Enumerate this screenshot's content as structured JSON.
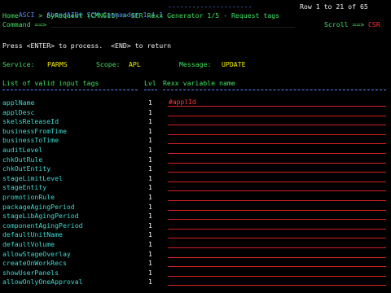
{
  "header": {
    "product": "ASCI - AbendAID® SCM Commander 1.4.1",
    "rule": "---------------------",
    "row_status": "Row 1 to 21 of 65",
    "breadcrumb": "Home     > byRequest (CMN611) > SER Rexx Generator 1/5 - Request tags",
    "command_label": "Command ==>",
    "scroll_label": "Scroll ==>",
    "scroll_value": "CSR"
  },
  "instructions": {
    "text": "Press <ENTER> to process.  <END> to return"
  },
  "context": {
    "service_label": "Service:",
    "service_value": "PARMS",
    "scope_label": "Scope:",
    "scope_value": "APL",
    "message_label": "Message:",
    "message_value": "UPDATE"
  },
  "table": {
    "col_tags": "List of valid input tags",
    "col_lvl": "Lvl",
    "col_rexx": "Rexx variable name",
    "rows": [
      {
        "tag": "applName",
        "lvl": "1",
        "rexx": "#applId"
      },
      {
        "tag": "applDesc",
        "lvl": "1",
        "rexx": ""
      },
      {
        "tag": "skelsReleaseId",
        "lvl": "1",
        "rexx": ""
      },
      {
        "tag": "businessFromTime",
        "lvl": "1",
        "rexx": ""
      },
      {
        "tag": "businessToTime",
        "lvl": "1",
        "rexx": ""
      },
      {
        "tag": "auditLevel",
        "lvl": "1",
        "rexx": ""
      },
      {
        "tag": "chkOutRule",
        "lvl": "1",
        "rexx": ""
      },
      {
        "tag": "chkOutEntity",
        "lvl": "1",
        "rexx": ""
      },
      {
        "tag": "stageLimitLevel",
        "lvl": "1",
        "rexx": ""
      },
      {
        "tag": "stageEntity",
        "lvl": "1",
        "rexx": ""
      },
      {
        "tag": "promotionRule",
        "lvl": "1",
        "rexx": ""
      },
      {
        "tag": "packageAgingPeriod",
        "lvl": "1",
        "rexx": ""
      },
      {
        "tag": "stageLibAgingPeriod",
        "lvl": "1",
        "rexx": ""
      },
      {
        "tag": "componentAgingPeriod",
        "lvl": "1",
        "rexx": ""
      },
      {
        "tag": "defaultUnitName",
        "lvl": "1",
        "rexx": ""
      },
      {
        "tag": "defaultVolume",
        "lvl": "1",
        "rexx": ""
      },
      {
        "tag": "allowStageOverlay",
        "lvl": "1",
        "rexx": ""
      },
      {
        "tag": "createOnWorkRecs",
        "lvl": "1",
        "rexx": ""
      },
      {
        "tag": "showUserPanels",
        "lvl": "1",
        "rexx": ""
      },
      {
        "tag": "allowOnlyOneApproval",
        "lvl": "1",
        "rexx": ""
      }
    ]
  },
  "colors": {
    "background": "#000000",
    "title": "#5a8cff",
    "tag": "#3fd8d0",
    "field_label": "#3fe060",
    "value": "#f4f000",
    "input_line": "#d42020",
    "input_text": "#ff3b3b"
  }
}
